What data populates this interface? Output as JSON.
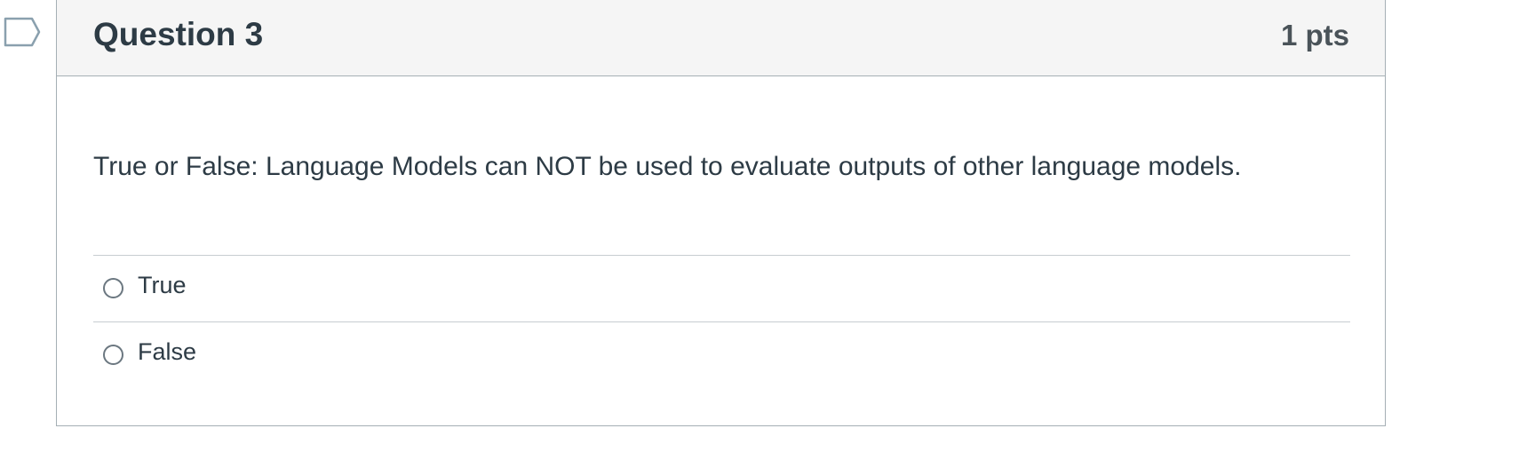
{
  "question": {
    "title": "Question 3",
    "points": "1 pts",
    "text": "True or False: Language Models can NOT be used to evaluate outputs of other language models.",
    "flag_icon": "flag-bookmark-icon",
    "answers": [
      {
        "label": "True",
        "selected": false
      },
      {
        "label": "False",
        "selected": false
      }
    ]
  },
  "colors": {
    "header_bg": "#f5f5f5",
    "border": "#a5afb5",
    "text": "#2d3b45",
    "divider": "#c7cdd1"
  }
}
